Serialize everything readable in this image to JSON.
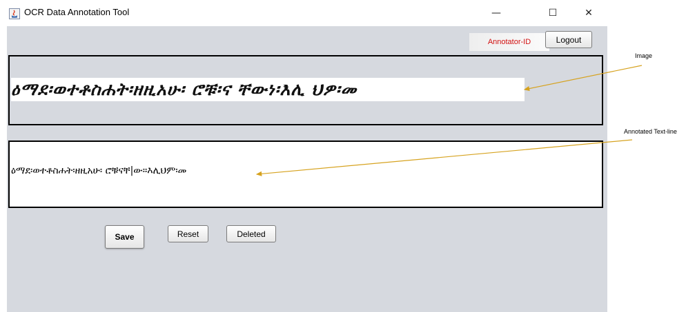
{
  "window": {
    "title": "OCR Data Annotation Tool",
    "icon": "java-app-icon",
    "controls": {
      "minimize": "—",
      "maximize": "☐",
      "close": "✕"
    }
  },
  "header": {
    "annotator_id": "Annotator-ID",
    "logout_label": "Logout"
  },
  "image_panel": {
    "line_image_text": "ዕማደ፡ወተቶስሐት፡ዘዚአሁ፡ ሮቹ፡ና ቸውነ፡እሊ ህዎ፡መ"
  },
  "text_panel": {
    "annotated_text": "ዕማደ፡ወተቶስሐት፡ዘዚአሁ፡ ሮቹናቸ|ው።እሊህም፡መ"
  },
  "actions": {
    "save_label": "Save",
    "reset_label": "Reset",
    "delete_label": "Deleted"
  },
  "callouts": {
    "image_label": "Image",
    "text_label": "Annotated Text-line",
    "arrow_color": "#d6a21e"
  },
  "colors": {
    "panel_bg": "#d6d9df",
    "annotator_text": "#d21010"
  }
}
